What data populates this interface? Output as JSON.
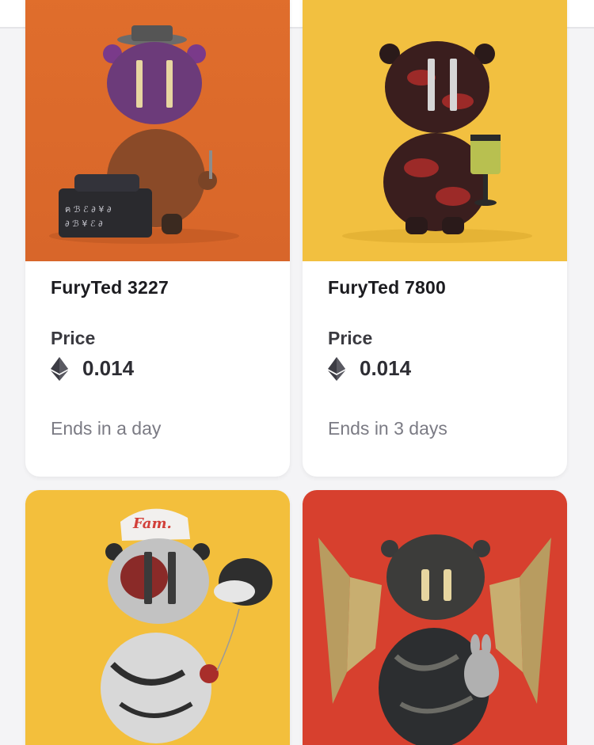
{
  "colors": {
    "orange_bg": "#dc6a2c",
    "yellow_bg": "#f3bf3c",
    "red_bg": "#d7402e",
    "header_logo": "#3b78d8"
  },
  "cards": [
    {
      "name": "FuryTed 3227",
      "price_label": "Price",
      "currency_icon": "ethereum-icon",
      "price": "0.014",
      "ends": "Ends in a day"
    },
    {
      "name": "FuryTed 7800",
      "price_label": "Price",
      "currency_icon": "ethereum-icon",
      "price": "0.014",
      "ends": "Ends in 3 days"
    },
    {
      "name": "",
      "price_label": "",
      "price": "",
      "ends": ""
    },
    {
      "name": "",
      "price_label": "",
      "price": "",
      "ends": ""
    }
  ]
}
